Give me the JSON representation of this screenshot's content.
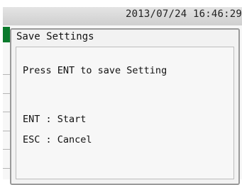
{
  "status_bar": {
    "datetime": "2013/07/24 16:46:29"
  },
  "dialog": {
    "title": "Save Settings",
    "message": "Press ENT to save Setting",
    "options": [
      {
        "label": "ENT : Start"
      },
      {
        "label": "ESC : Cancel"
      }
    ]
  },
  "colors": {
    "accent_green": "#0a7a2c",
    "dialog_border": "#9a9a9a",
    "dialog_background": "#f2f2f2"
  }
}
